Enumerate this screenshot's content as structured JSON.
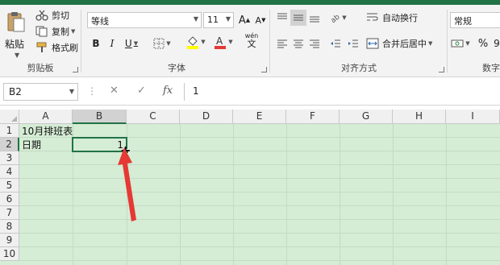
{
  "ribbon": {
    "clipboard": {
      "paste_label": "粘贴",
      "cut_label": "剪切",
      "copy_label": "复制",
      "format_painter_label": "格式刷",
      "group_label": "剪贴板"
    },
    "font": {
      "font_name": "等线",
      "font_size": "11",
      "bold": "B",
      "italic": "I",
      "underline": "U",
      "grow_font": "A",
      "shrink_font": "A",
      "phonetic": "wén",
      "phonetic_sub": "文",
      "group_label": "字体"
    },
    "alignment": {
      "wrap_text_label": "自动换行",
      "merge_center_label": "合并后居中",
      "group_label": "对齐方式"
    },
    "number": {
      "format_value": "常规",
      "percent": "%",
      "comma": "9",
      "group_label": "数字"
    }
  },
  "formula_bar": {
    "name_box": "B2",
    "dots": "⋮",
    "cancel": "✕",
    "enter": "✓",
    "fx": "fx",
    "content": "1"
  },
  "sheet": {
    "columns": [
      "A",
      "B",
      "C",
      "D",
      "E",
      "F",
      "G",
      "H",
      "I"
    ],
    "rows": [
      "1",
      "2",
      "3",
      "4",
      "5",
      "6",
      "7",
      "8",
      "9",
      "10"
    ],
    "cells": {
      "A1": "10月排班表",
      "A2": "日期",
      "B2": "1"
    },
    "active_cell": "B2"
  },
  "colors": {
    "excel_green": "#217346",
    "grid_fill": "#d5ecd5",
    "annotation_red": "#e53935"
  }
}
